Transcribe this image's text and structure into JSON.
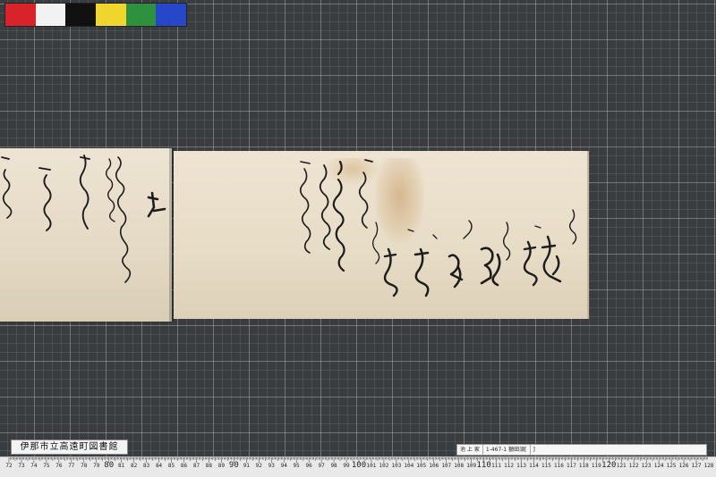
{
  "color_chart": {
    "swatches": [
      "#d8232a",
      "#f2f2f2",
      "#111111",
      "#f0d52c",
      "#2e9140",
      "#2648c8"
    ]
  },
  "scroll": {
    "paper_color": "#e9dfcb",
    "ink_color": "#1c1c1c",
    "stain_color": "#c4965c"
  },
  "library_label": "伊那市立高遠町図書館",
  "catalog_strip": {
    "cells": [
      "池 上 家",
      "1-467-1 額田須[",
      "]"
    ]
  },
  "ruler": {
    "start": 72,
    "end": 128,
    "emphasized": [
      80,
      90,
      100,
      110,
      120
    ]
  }
}
